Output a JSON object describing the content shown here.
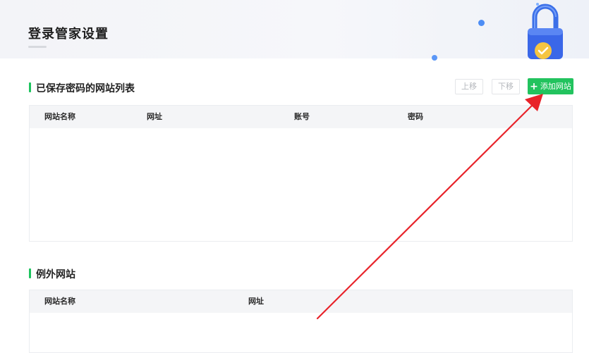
{
  "page": {
    "title": "登录管家设置"
  },
  "saved_sites": {
    "title": "已保存密码的网站列表",
    "move_up_label": "上移",
    "move_down_label": "下移",
    "add_label": "添加网站",
    "columns": [
      "网站名称",
      "网址",
      "账号",
      "密码"
    ],
    "rows": []
  },
  "exceptions": {
    "title": "例外网站",
    "columns": [
      "网站名称",
      "网址"
    ],
    "rows": []
  },
  "colors": {
    "accent_green": "#22c35e",
    "annotation_red": "#e8232a",
    "lock_blue": "#3a6ff2",
    "check_yellow": "#f5c542"
  },
  "icons": [
    "lock-illustration-icon",
    "plus-icon",
    "red-arrow-annotation"
  ]
}
